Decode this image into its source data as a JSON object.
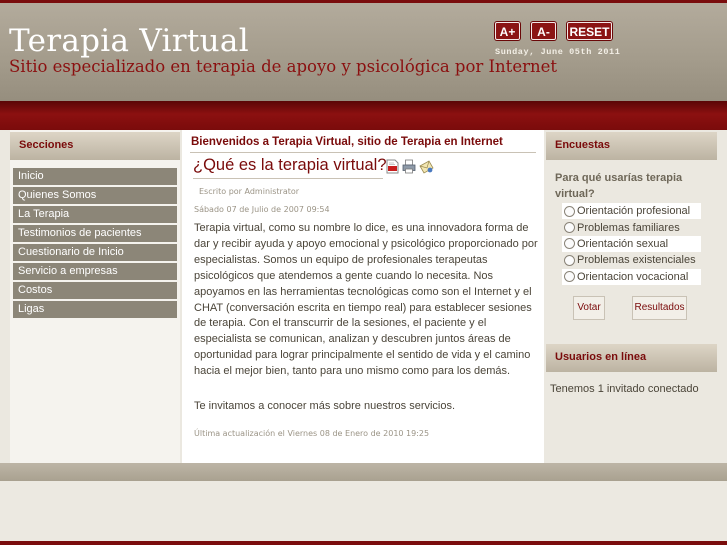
{
  "header": {
    "title": "Terapia Virtual",
    "subtitle": "Sitio especializado en terapia de apoyo y psicológica por Internet",
    "font_increase_label": "A+",
    "font_decrease_label": "A-",
    "reset_label": "RESET",
    "date": "Sunday, June 05th 2011"
  },
  "colors": {
    "brand_red": "#7a0b0b",
    "header_bg": "#a39b8b",
    "nav_item_bg": "#8c8678"
  },
  "sidebar": {
    "title": "Secciones",
    "items": [
      {
        "label": "Inicio"
      },
      {
        "label": "Quienes Somos"
      },
      {
        "label": "La Terapia"
      },
      {
        "label": "Testimonios de pacientes"
      },
      {
        "label": "Cuestionario de Inicio"
      },
      {
        "label": "Servicio a empresas"
      },
      {
        "label": "Costos"
      },
      {
        "label": "Ligas"
      }
    ]
  },
  "main": {
    "welcome": "Bienvenidos a Terapia Virtual, sitio de Terapia en Internet",
    "article_title": "¿Qué es la terapia virtual?",
    "author": "Escrito por Administrator",
    "created": "Sábado 07 de Julio de 2007 09:54",
    "body": "Terapia virtual, como su nombre lo dice, es una innovadora forma de dar y recibir ayuda y apoyo emocional y psicológico proporcionado por especialistas. Somos un equipo de profesionales terapeutas psicológicos que atendemos a gente cuando lo necesita. Nos apoyamos en las herramientas tecnológicas como son el Internet y el CHAT (conversación escrita en tiempo real) para establecer sesiones de terapia. Con el transcurrir de la sesiones, el paciente y el especialista se comunican, analizan y descubren juntos áreas de oportunidad para lograr principalmente el sentido de vida y el camino hacia el mejor bien, tanto para uno mismo como para los demás.",
    "body2": "Te invitamos a conocer más sobre nuestros servicios.",
    "updated": "Última actualización el Viernes 08 de Enero de 2010 19:25",
    "icons": [
      "pdf-icon",
      "print-icon",
      "email-icon"
    ]
  },
  "poll": {
    "title": "Encuestas",
    "question": "Para qué usarías terapia virtual?",
    "options": [
      {
        "label": "Orientación profesional"
      },
      {
        "label": "Problemas familiares"
      },
      {
        "label": "Orientación sexual"
      },
      {
        "label": "Problemas existenciales"
      },
      {
        "label": "Orientacion vocacional"
      }
    ],
    "vote_label": "Votar",
    "results_label": "Resultados"
  },
  "online": {
    "title": "Usuarios en línea",
    "text": "Tenemos 1 invitado conectado"
  }
}
